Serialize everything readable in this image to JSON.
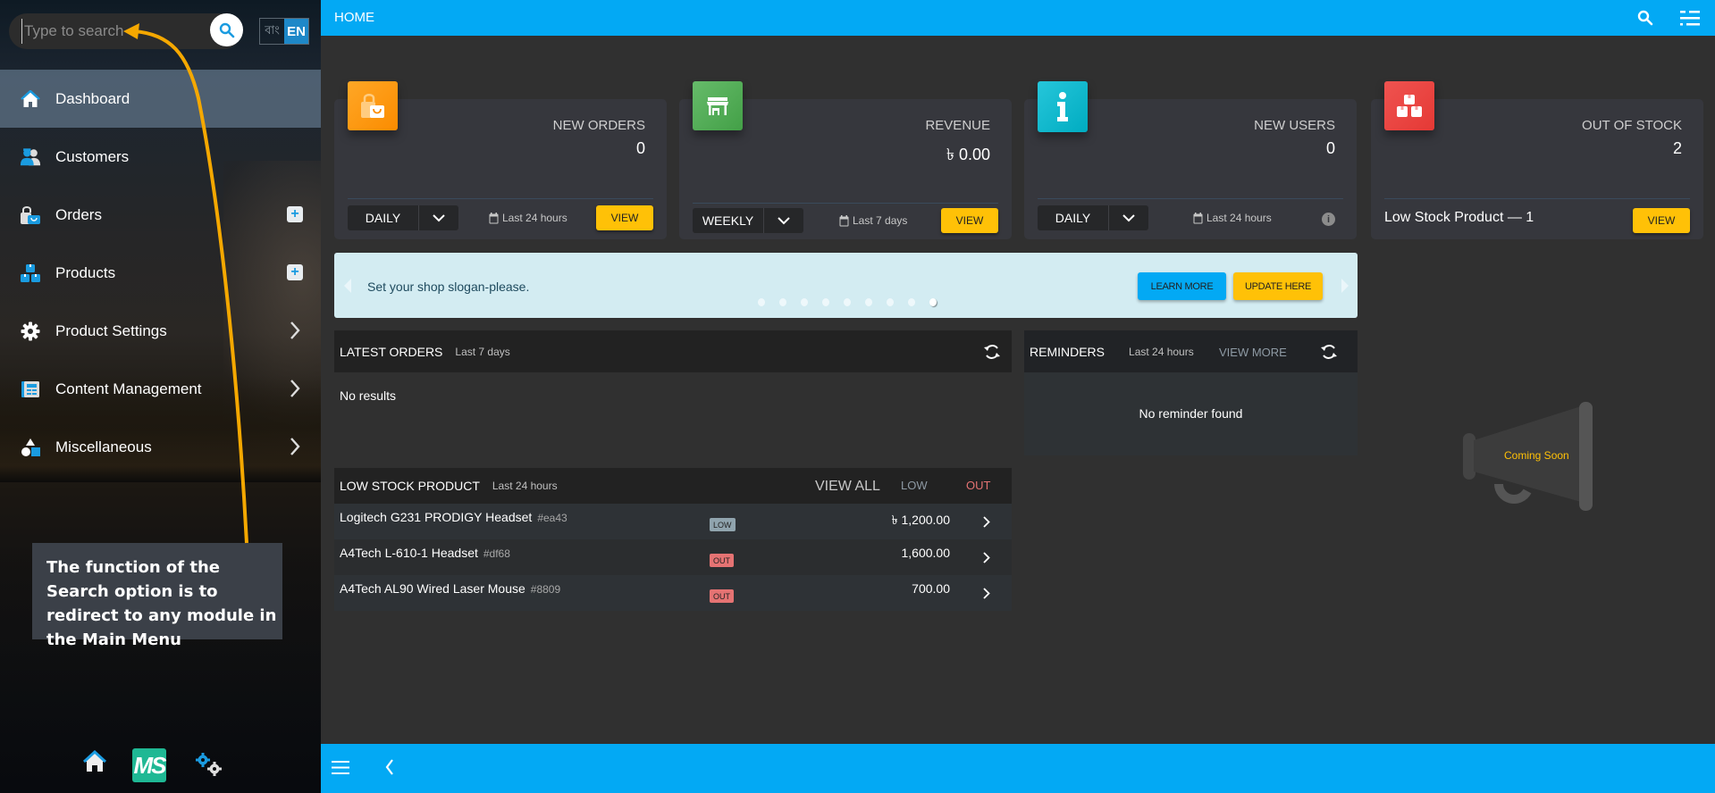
{
  "sidebar": {
    "search": {
      "placeholder": "Type to search",
      "value": ""
    },
    "language": {
      "options": [
        "বাং",
        "EN"
      ],
      "selected": "EN"
    },
    "menu": [
      {
        "label": "Dashboard",
        "icon": "home-icon",
        "active": true,
        "action": "none"
      },
      {
        "label": "Customers",
        "icon": "customers-icon",
        "active": false,
        "action": "none"
      },
      {
        "label": "Orders",
        "icon": "orders-icon",
        "active": false,
        "action": "add"
      },
      {
        "label": "Products",
        "icon": "products-icon",
        "active": false,
        "action": "add"
      },
      {
        "label": "Product Settings",
        "icon": "gear-icon",
        "active": false,
        "action": "expand"
      },
      {
        "label": "Content Management",
        "icon": "content-icon",
        "active": false,
        "action": "expand"
      },
      {
        "label": "Miscellaneous",
        "icon": "shapes-icon",
        "active": false,
        "action": "expand"
      }
    ],
    "bottom": {
      "logo_text": "MS",
      "icons": [
        "home-icon",
        "logo-icon",
        "settings-gears-icon"
      ]
    }
  },
  "annotation": {
    "text": "The function of the Search option is to redirect to any module in the Main Menu",
    "color": "#f5a800"
  },
  "topbar": {
    "title": "HOME",
    "icons": [
      "search-icon",
      "layout-toggle-icon"
    ]
  },
  "bottombar": {
    "icons": [
      "hamburger-icon",
      "back-icon"
    ]
  },
  "cards": [
    {
      "name": "NEW ORDERS",
      "value": "0",
      "color": "#ff9800",
      "icon": "shopping-bag-icon",
      "period": "DAILY",
      "range": "Last 24 hours",
      "button": "VIEW"
    },
    {
      "name": "REVENUE",
      "value": "৳  0.00",
      "color": "#4caf50",
      "icon": "store-icon",
      "period": "WEEKLY",
      "range": "Last 7 days",
      "button": "VIEW"
    },
    {
      "name": "NEW USERS",
      "value": "0",
      "color": "#00bcd4",
      "icon": "info-icon",
      "period": "DAILY",
      "range": "Last 24 hours",
      "info": "i"
    },
    {
      "name": "OUT OF STOCK",
      "value": "2",
      "color": "#f44336",
      "icon": "boxes-icon",
      "note": "Low Stock Product — 1",
      "button": "VIEW"
    }
  ],
  "banner": {
    "slogan": "Set your shop slogan-please.",
    "learn_more": "LEARN MORE",
    "update_here": "UPDATE HERE",
    "slides_total": 9,
    "slide_active": 9
  },
  "latest_orders": {
    "title": "LATEST ORDERS",
    "range": "Last 7 days",
    "empty": "No results"
  },
  "reminders": {
    "title": "REMINDERS",
    "range": "Last 24 hours",
    "view_more": "VIEW MORE",
    "empty": "No reminder found"
  },
  "low_stock": {
    "title": "LOW STOCK PRODUCT",
    "range": "Last 24 hours",
    "view_all": "VIEW ALL",
    "filter_low": "LOW",
    "filter_out": "OUT",
    "rows": [
      {
        "name": "Logitech G231 PRODIGY Headset",
        "sku": "#ea43",
        "status": "LOW",
        "price": "৳ 1,200.00"
      },
      {
        "name": "A4Tech L-610-1 Headset",
        "sku": "#df68",
        "status": "OUT",
        "price": "1,600.00"
      },
      {
        "name": "A4Tech AL90 Wired Laser Mouse",
        "sku": "#8809",
        "status": "OUT",
        "price": "700.00"
      }
    ]
  },
  "coming_soon": {
    "text": "Coming Soon"
  }
}
